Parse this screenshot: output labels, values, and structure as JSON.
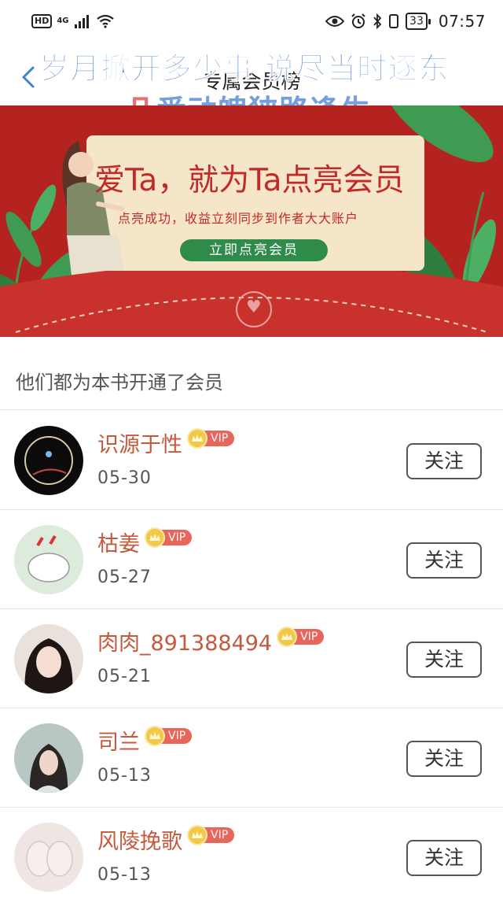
{
  "status_bar": {
    "hd": "HD",
    "network": "4G",
    "battery": "33",
    "time": "07:57"
  },
  "header": {
    "title": "专属会员榜",
    "overlay_line1": "岁月掀开多少事 说尽当时逐东",
    "overlay_line2_first": "几",
    "overlay_line2_rest": "番动魄狭路逢生"
  },
  "banner": {
    "headline": "爱Ta，就为Ta点亮会员",
    "subtext": "点亮成功，收益立刻同步到作者大大账户",
    "button": "立即点亮会员"
  },
  "section": {
    "title": "他们都为本书开通了会员"
  },
  "vip_label": "VIP",
  "follow_label": "关注",
  "members": [
    {
      "name": "识源于性",
      "date": "05-30"
    },
    {
      "name": "枯姜",
      "date": "05-27"
    },
    {
      "name": "肉肉_891388494",
      "date": "05-21"
    },
    {
      "name": "司兰",
      "date": "05-13"
    },
    {
      "name": "风陵挽歌",
      "date": "05-13"
    }
  ],
  "colors": {
    "accent_name": "#c45a3c",
    "banner_red": "#b52320",
    "banner_button": "#2f8b4a",
    "vip_badge": "#e7665b",
    "overlay_blue": "#4f86d3"
  }
}
